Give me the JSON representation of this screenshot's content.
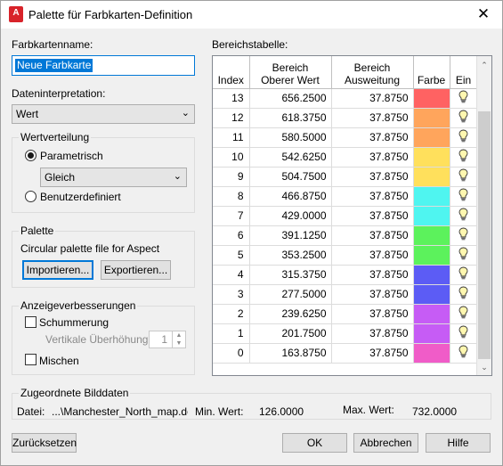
{
  "window": {
    "title": "Palette für Farbkarten-Definition",
    "app_icon_letter": "A",
    "close_glyph": "✕"
  },
  "left": {
    "name_label": "Farbkartenname:",
    "name_value": "Neue Farbkarte",
    "interp_label": "Dateninterpretation:",
    "interp_value": "Wert",
    "wertverteilung": {
      "label": "Wertverteilung",
      "parametric_label": "Parametrisch",
      "parametric_mode": "Gleich",
      "custom_label": "Benutzerdefiniert"
    },
    "palette": {
      "label": "Palette",
      "description": "Circular palette file for Aspect",
      "import_button": "Importieren...",
      "export_button": "Exportieren..."
    },
    "enhancements": {
      "label": "Anzeigeverbesserungen",
      "shading_label": "Schummerung",
      "exaggeration_label": "Vertikale Überhöhung",
      "exaggeration_value": "1",
      "blend_label": "Mischen"
    }
  },
  "table": {
    "label": "Bereichstabelle:",
    "headers": [
      "Index",
      "Bereich\nOberer Wert",
      "Bereich\nAusweitung",
      "Farbe",
      "Ein"
    ],
    "rows": [
      {
        "index": "13",
        "upper": "656.2500",
        "extent": "37.8750",
        "color": "#ff6262"
      },
      {
        "index": "12",
        "upper": "618.3750",
        "extent": "37.8750",
        "color": "#ffa55c"
      },
      {
        "index": "11",
        "upper": "580.5000",
        "extent": "37.8750",
        "color": "#ffa55c"
      },
      {
        "index": "10",
        "upper": "542.6250",
        "extent": "37.8750",
        "color": "#ffe05c"
      },
      {
        "index": "9",
        "upper": "504.7500",
        "extent": "37.8750",
        "color": "#ffe05c"
      },
      {
        "index": "8",
        "upper": "466.8750",
        "extent": "37.8750",
        "color": "#4ff5f0"
      },
      {
        "index": "7",
        "upper": "429.0000",
        "extent": "37.8750",
        "color": "#4ff5f0"
      },
      {
        "index": "6",
        "upper": "391.1250",
        "extent": "37.8750",
        "color": "#5cf25c"
      },
      {
        "index": "5",
        "upper": "353.2500",
        "extent": "37.8750",
        "color": "#5cf25c"
      },
      {
        "index": "4",
        "upper": "315.3750",
        "extent": "37.8750",
        "color": "#5c5cf5"
      },
      {
        "index": "3",
        "upper": "277.5000",
        "extent": "37.8750",
        "color": "#5c5cf5"
      },
      {
        "index": "2",
        "upper": "239.6250",
        "extent": "37.8750",
        "color": "#c65cf5"
      },
      {
        "index": "1",
        "upper": "201.7500",
        "extent": "37.8750",
        "color": "#c65cf5"
      },
      {
        "index": "0",
        "upper": "163.8750",
        "extent": "37.8750",
        "color": "#f05cc8"
      }
    ],
    "on_icon": "lightbulb-icon"
  },
  "image_data": {
    "label": "Zugeordnete Bilddaten",
    "file_label": "Datei:",
    "file_value": "...\\Manchester_North_map.dem",
    "min_label": "Min. Wert:",
    "min_value": "126.0000",
    "max_label": "Max. Wert:",
    "max_value": "732.0000"
  },
  "buttons": {
    "reset": "Zurücksetzen",
    "ok": "OK",
    "cancel": "Abbrechen",
    "help": "Hilfe"
  }
}
